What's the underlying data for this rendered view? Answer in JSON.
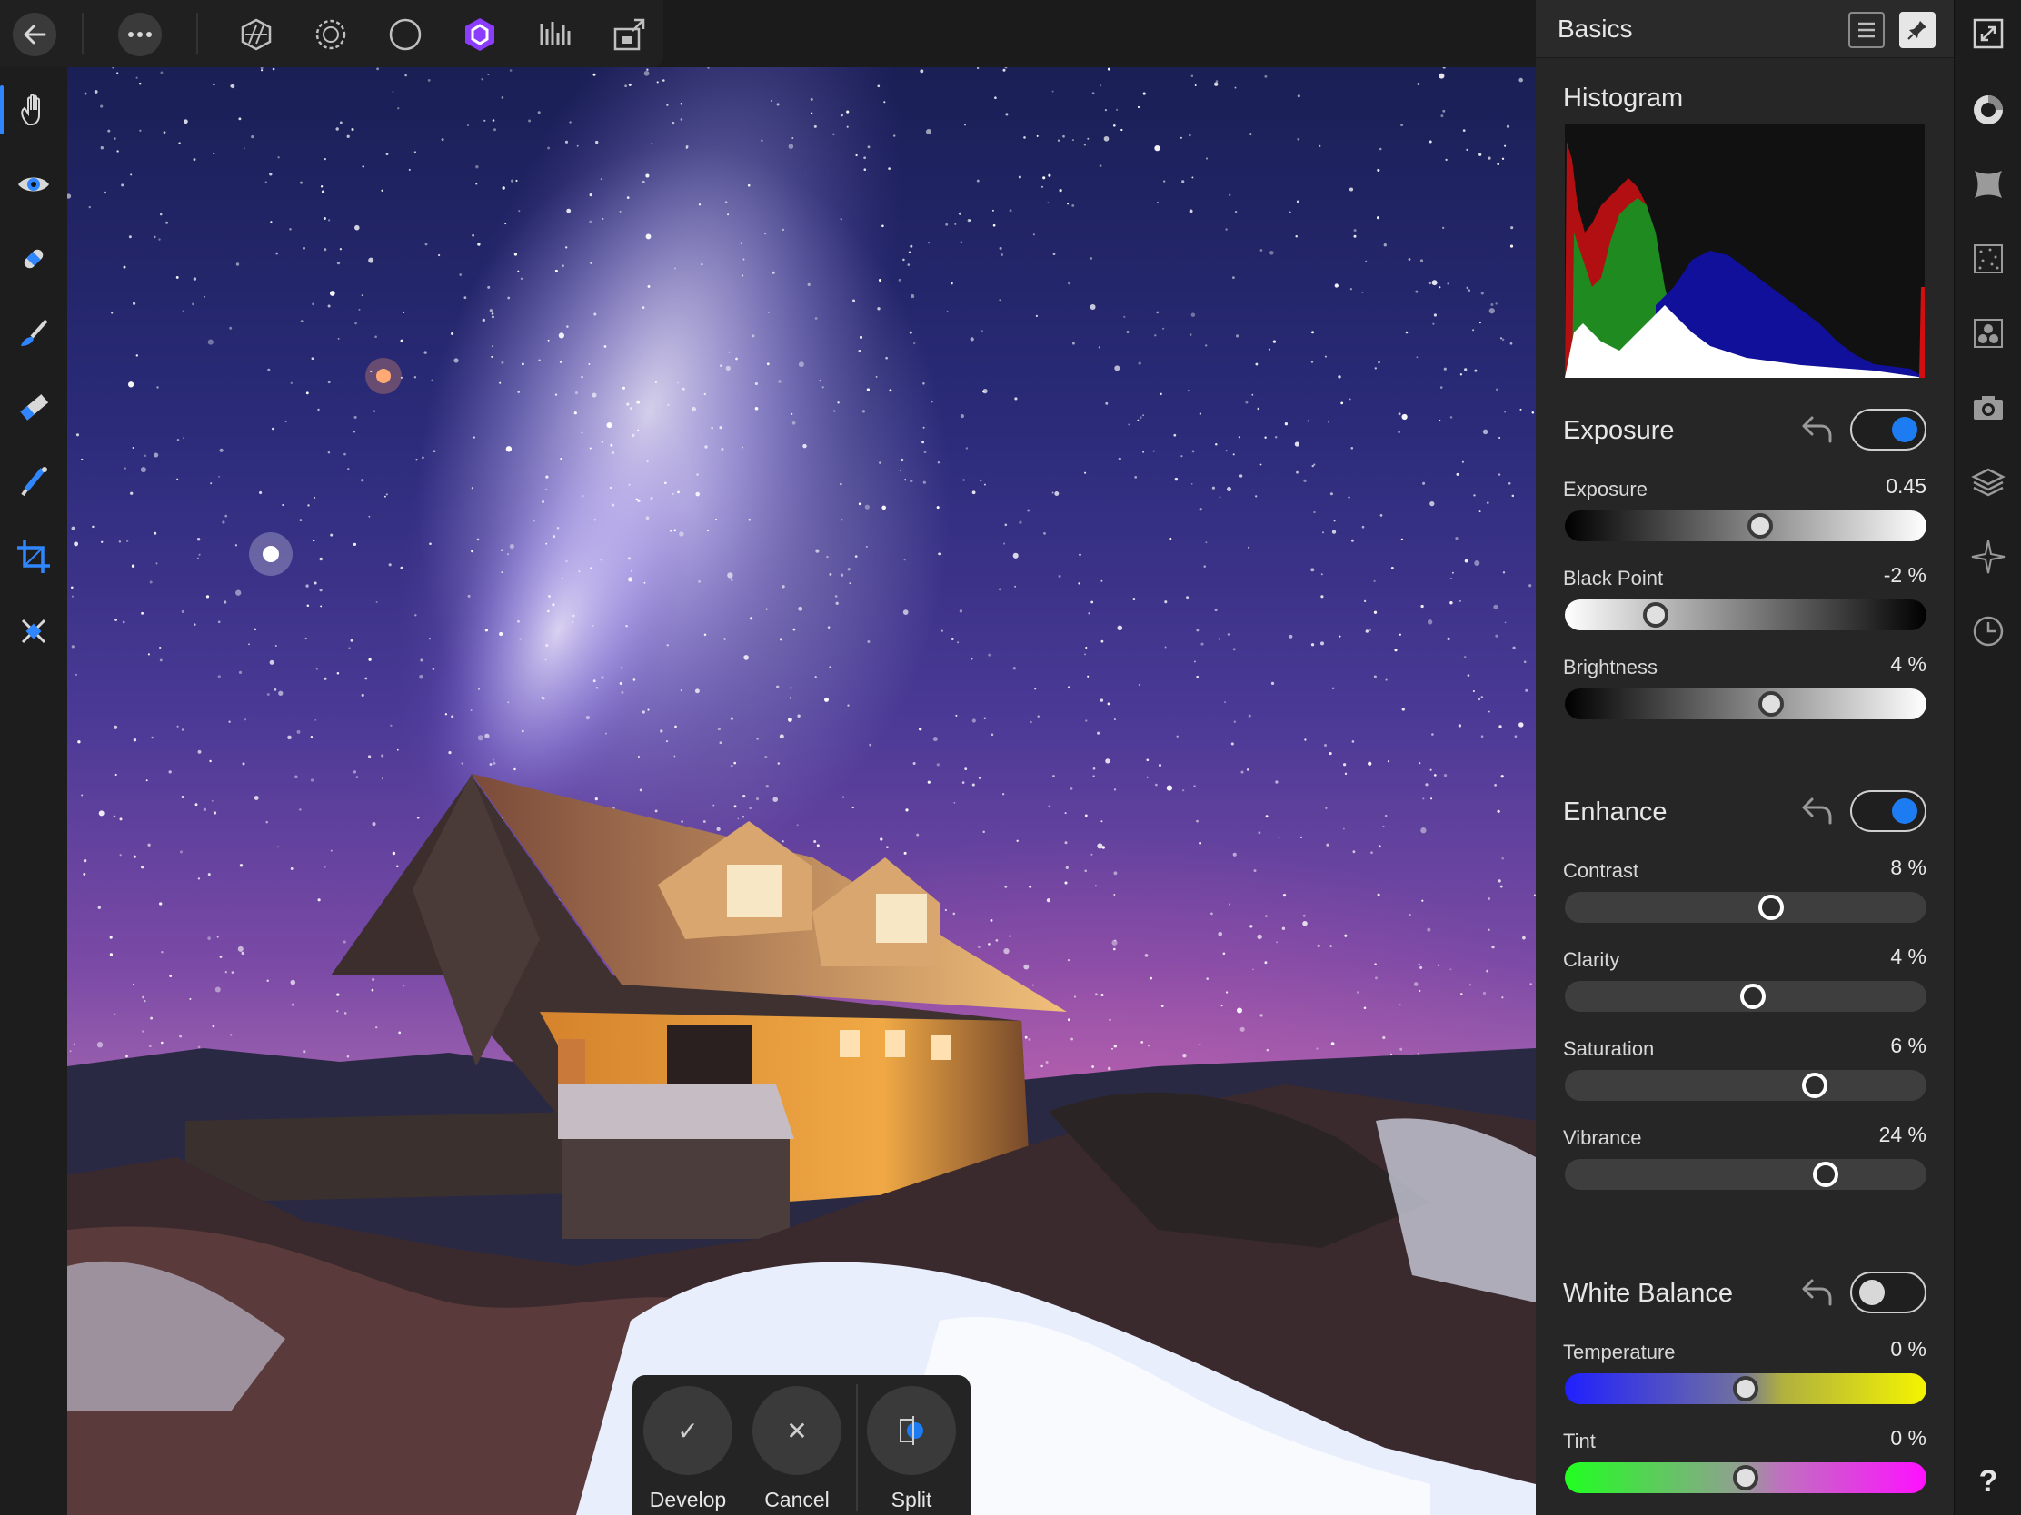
{
  "top_bar": {
    "back_icon": "arrow-left-icon",
    "more_icon": "ellipsis-icon",
    "personas": [
      "photo-persona-icon",
      "liquify-persona-icon",
      "develop-persona-icon",
      "tone-mapping-persona-icon",
      "export-persona-icon",
      "share-icon"
    ],
    "active_persona": "develop-persona-icon",
    "accent": "#8b3cff"
  },
  "left_tools": [
    "view-tool-icon",
    "red-eye-tool-icon",
    "blemish-tool-icon",
    "brush-tool-icon",
    "eraser-tool-icon",
    "gradient-tool-icon",
    "crop-tool-icon",
    "overlay-tool-icon"
  ],
  "panel": {
    "title": "Basics",
    "histogram_title": "Histogram",
    "sections": [
      {
        "title": "Exposure",
        "enabled": true,
        "params": [
          {
            "label": "Exposure",
            "value": "0.45",
            "fraction": 0.54
          },
          {
            "label": "Black Point",
            "value": "-2 %",
            "fraction": 0.25
          },
          {
            "label": "Brightness",
            "value": "4 %",
            "fraction": 0.57
          }
        ]
      },
      {
        "title": "Enhance",
        "enabled": true,
        "params": [
          {
            "label": "Contrast",
            "value": "8 %",
            "fraction": 0.57
          },
          {
            "label": "Clarity",
            "value": "4 %",
            "fraction": 0.52
          },
          {
            "label": "Saturation",
            "value": "6 %",
            "fraction": 0.69
          },
          {
            "label": "Vibrance",
            "value": "24 %",
            "fraction": 0.72
          }
        ]
      },
      {
        "title": "White Balance",
        "enabled": false,
        "params": [
          {
            "label": "Temperature",
            "value": "0 %",
            "fraction": 0.5
          },
          {
            "label": "Tint",
            "value": "0 %",
            "fraction": 0.5
          }
        ]
      }
    ]
  },
  "right_tools": [
    "fullscreen-icon",
    "basics-icon",
    "lens-icon",
    "noise-icon",
    "detail-icon",
    "camera-icon",
    "layers-icon",
    "navigator-icon",
    "history-icon",
    "help-icon"
  ],
  "help_label": "?",
  "action_bar": {
    "develop_label": "Develop",
    "cancel_label": "Cancel",
    "split_label": "Split",
    "develop_glyph": "✓",
    "cancel_glyph": "✕"
  },
  "colors": {
    "toggle_on": "#1e7cf2",
    "toggle_off": "#d8d8d8",
    "panel_bg": "#262626"
  }
}
